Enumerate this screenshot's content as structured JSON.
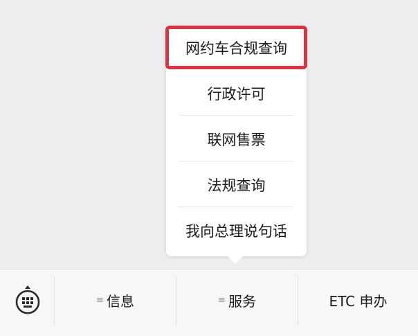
{
  "popup_menu": {
    "items": [
      {
        "label": "网约车合规查询",
        "highlighted": true
      },
      {
        "label": "行政许可",
        "highlighted": false
      },
      {
        "label": "联网售票",
        "highlighted": false
      },
      {
        "label": "法规查询",
        "highlighted": false
      },
      {
        "label": "我向总理说句话",
        "highlighted": false
      }
    ],
    "highlight_color": "#d93444"
  },
  "bottom_bar": {
    "keyboard_icon": "keyboard-icon",
    "tabs": [
      {
        "label": "信息",
        "has_submenu": true
      },
      {
        "label": "服务",
        "has_submenu": true
      },
      {
        "label": "ETC 申办",
        "has_submenu": false
      }
    ]
  }
}
